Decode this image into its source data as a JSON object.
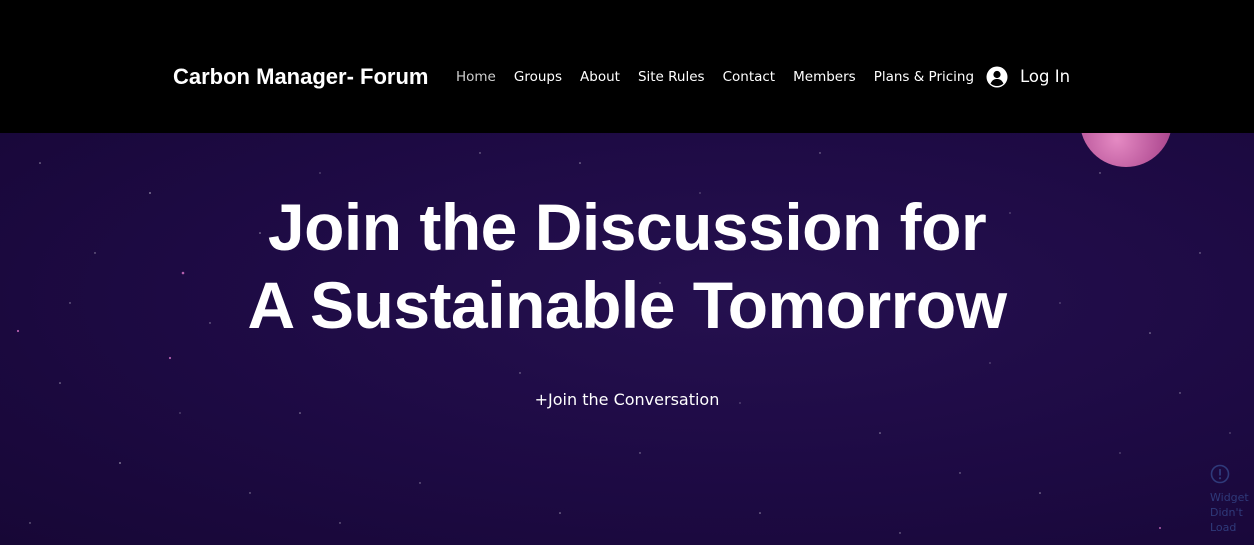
{
  "header": {
    "site_title": "Carbon Manager- Forum",
    "nav": [
      {
        "label": "Home",
        "active": true
      },
      {
        "label": "Groups"
      },
      {
        "label": "About"
      },
      {
        "label": "Site Rules"
      },
      {
        "label": "Contact"
      },
      {
        "label": "Members"
      },
      {
        "label": "Plans & Pricing"
      }
    ],
    "login_label": "Log In",
    "login_icon": "user-avatar-icon"
  },
  "hero": {
    "headline_line1": "Join the Discussion for",
    "headline_line2": "A Sustainable Tomorrow",
    "cta_label": "+Join the Conversation"
  },
  "widget": {
    "icon": "alert-circle-icon",
    "message": "Widget Didn't Load"
  },
  "colors": {
    "header_bg": "#000000",
    "hero_bg": "#1e0b44",
    "planet": "#c95ea6",
    "text": "#ffffff",
    "widget_text": "#2f3a7a"
  }
}
